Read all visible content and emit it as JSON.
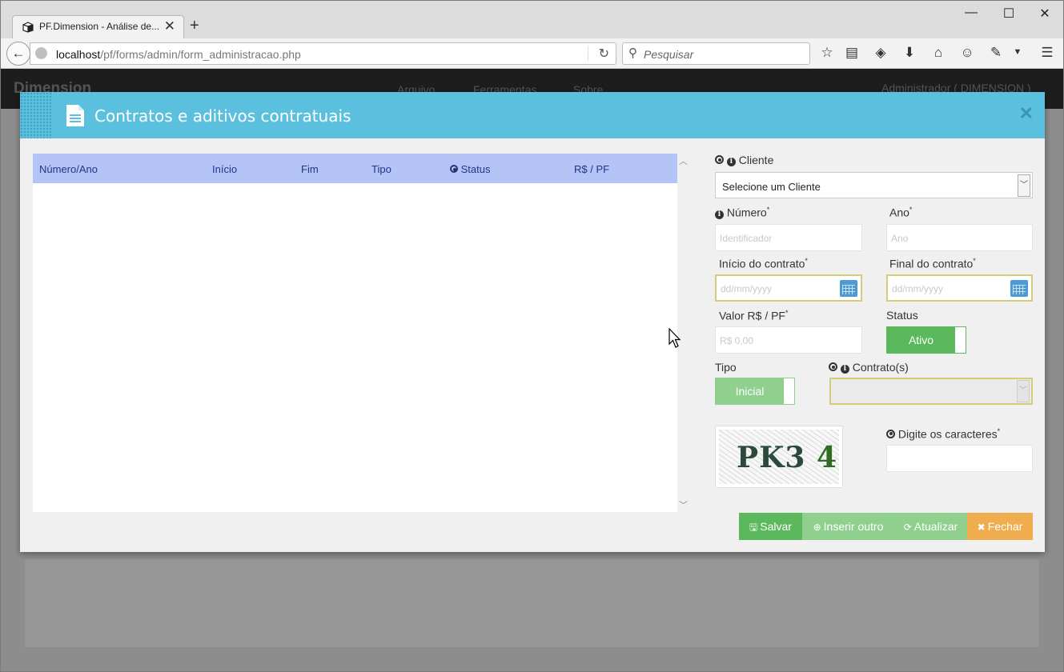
{
  "browser": {
    "tab_title": "PF.Dimension - Análise de...",
    "url_host": "localhost",
    "url_path": "/pf/forms/admin/form_administracao.php",
    "search_placeholder": "Pesquisar"
  },
  "app": {
    "brand": "Dimension",
    "menu": [
      "Arquivo",
      "Ferramentas",
      "Sobre"
    ],
    "user": "Administrador ( DIMENSION )"
  },
  "modal": {
    "title": "Contratos e aditivos contratuais",
    "grid": {
      "columns": [
        "Número/Ano",
        "Início",
        "Fim",
        "Tipo",
        "Status",
        "R$ / PF"
      ],
      "rows": []
    },
    "form": {
      "cliente_label": "Cliente",
      "cliente_value": "Selecione um Cliente",
      "numero_label": "Número",
      "numero_placeholder": "Identificador",
      "ano_label": "Ano",
      "ano_placeholder": "Ano",
      "inicio_label": "Início do contrato",
      "inicio_placeholder": "dd/mm/yyyy",
      "final_label": "Final do contrato",
      "final_placeholder": "dd/mm/yyyy",
      "valor_label": "Valor R$ / PF",
      "valor_placeholder": "R$ 0,00",
      "status_label": "Status",
      "status_value": "Ativo",
      "tipo_label": "Tipo",
      "tipo_value": "Inicial",
      "contratos_label": "Contrato(s)",
      "captcha_label": "Digite os caracteres",
      "captcha_text_a": "PK3",
      "captcha_text_b": "4",
      "required_mark": "*"
    },
    "buttons": {
      "salvar": "Salvar",
      "inserir": "Inserir outro",
      "atualizar": "Atualizar",
      "fechar": "Fechar"
    }
  },
  "colors": {
    "header": "#5bc0de",
    "grid_head": "#b4c4f6",
    "success": "#5cb85c",
    "warning": "#f0ad4e"
  }
}
